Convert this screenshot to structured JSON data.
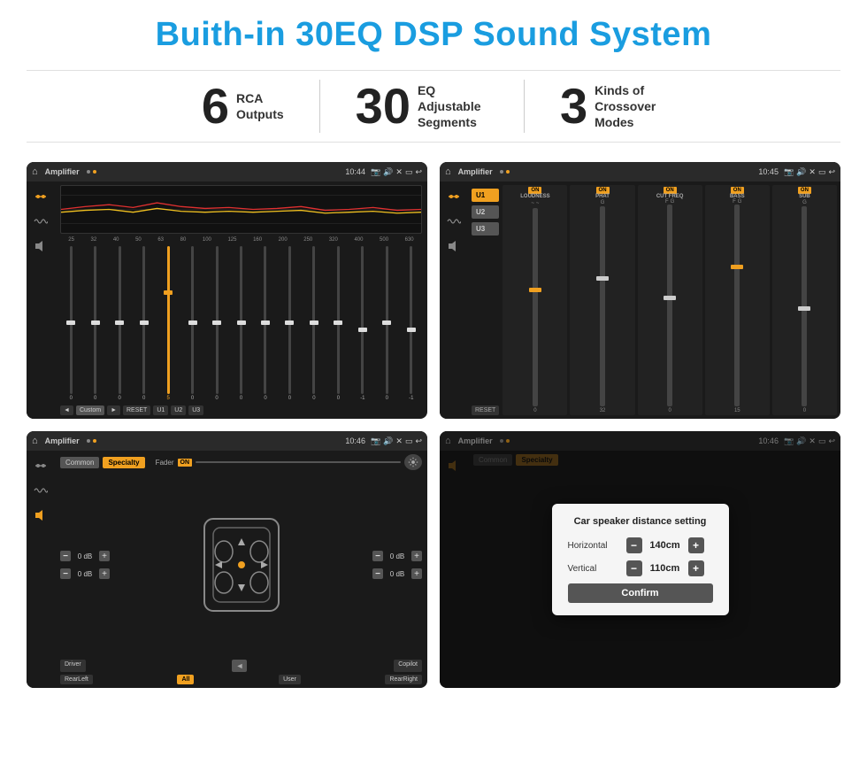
{
  "title": "Buith-in 30EQ DSP Sound System",
  "stats": [
    {
      "number": "6",
      "label": "RCA\nOutputs"
    },
    {
      "number": "30",
      "label": "EQ Adjustable\nSegments"
    },
    {
      "number": "3",
      "label": "Kinds of\nCrossover Modes"
    }
  ],
  "screens": [
    {
      "id": "eq-screen",
      "topbar": {
        "title": "Amplifier",
        "time": "10:44"
      },
      "type": "equalizer"
    },
    {
      "id": "crossover-screen",
      "topbar": {
        "title": "Amplifier",
        "time": "10:45"
      },
      "type": "crossover"
    },
    {
      "id": "speaker-screen",
      "topbar": {
        "title": "Amplifier",
        "time": "10:46"
      },
      "type": "speaker"
    },
    {
      "id": "distance-screen",
      "topbar": {
        "title": "Amplifier",
        "time": "10:46"
      },
      "type": "distance",
      "dialog": {
        "title": "Car speaker distance setting",
        "horizontal_label": "Horizontal",
        "horizontal_value": "140cm",
        "vertical_label": "Vertical",
        "vertical_value": "110cm",
        "confirm_label": "Confirm"
      }
    }
  ],
  "eq_freqs": [
    "25",
    "32",
    "40",
    "50",
    "63",
    "80",
    "100",
    "125",
    "160",
    "200",
    "250",
    "320",
    "400",
    "500",
    "630"
  ],
  "eq_vals": [
    "0",
    "0",
    "0",
    "0",
    "5",
    "0",
    "0",
    "0",
    "0",
    "0",
    "0",
    "0",
    "-1",
    "0",
    "-1"
  ],
  "eq_presets": [
    "Custom",
    "RESET",
    "U1",
    "U2",
    "U3"
  ],
  "crossover_channels": [
    "U1",
    "U2",
    "U3"
  ],
  "crossover_cols": [
    {
      "on": true,
      "label": "LOUDNESS"
    },
    {
      "on": true,
      "label": "PHAT"
    },
    {
      "on": true,
      "label": "CUT FREQ"
    },
    {
      "on": true,
      "label": "BASS"
    },
    {
      "on": true,
      "label": "SUB"
    }
  ],
  "speaker_tabs": [
    "Common",
    "Specialty"
  ],
  "speaker_buttons": [
    "Driver",
    "Copilot",
    "RearLeft",
    "All",
    "User",
    "RearRight"
  ],
  "dialog_title": "Car speaker distance setting",
  "dialog_horizontal": "140cm",
  "dialog_vertical": "110cm",
  "dialog_confirm": "Confirm"
}
